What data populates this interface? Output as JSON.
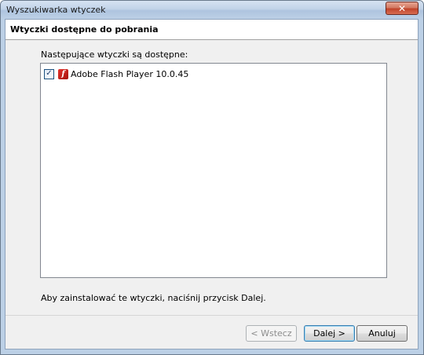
{
  "window": {
    "title": "Wyszukiwarka wtyczek",
    "close_label": "✕"
  },
  "header": {
    "title": "Wtyczki dostępne do pobrania"
  },
  "plugins": {
    "label": "Następujące wtyczki są dostępne:",
    "items": [
      {
        "name": "Adobe Flash Player 10.0.45",
        "checked": true,
        "icon": "flash-icon"
      }
    ]
  },
  "hint": "Aby zainstalować te wtyczki, naciśnij przycisk Dalej.",
  "buttons": {
    "back": "< Wstecz",
    "next": "Dalej >",
    "cancel": "Anuluj"
  }
}
